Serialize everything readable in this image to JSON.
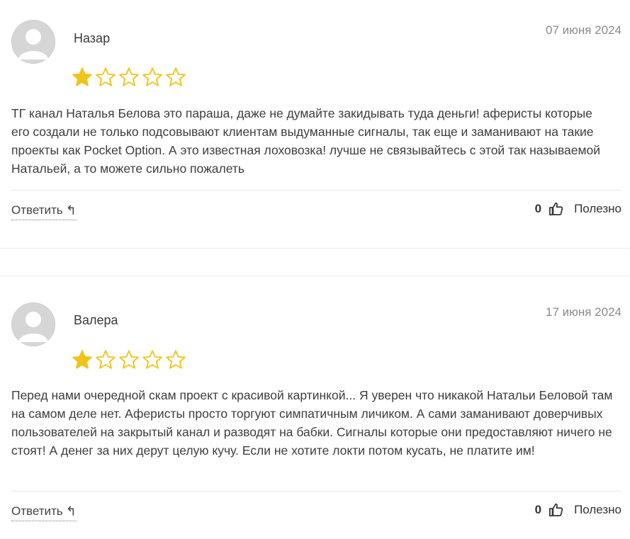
{
  "reviews": [
    {
      "author": "Назар",
      "date": "07 июня 2024",
      "rating": 1,
      "max_rating": 5,
      "text": "ТГ канал Наталья Белова это параша, даже не думайте закидывать туда деньги! аферисты которые его создали не только подсовывают клиентам выдуманные сигналы, так еще и заманивают на такие проекты как Pocket Option. А это известная лоховозка! лучше не связывайтесь с этой так называемой Натальей, а то можете сильно пожалеть",
      "reply_label": "Ответить",
      "helpful_count": "0",
      "helpful_label": "Полезно"
    },
    {
      "author": "Валера",
      "date": "17 июня 2024",
      "rating": 1,
      "max_rating": 5,
      "text": "Перед нами очередной скам проект с красивой картинкой... Я уверен что никакой Натальи Беловой там на самом деле нет. Аферисты просто торгуют симпатичным личиком. А сами заманивают доверчивых пользователей на закрытый канал и разводят на бабки. Сигналы которые они предоставляют ничего не стоят! А денег за них дерут целую кучу. Если не хотите локти потом кусать, не платите им!",
      "reply_label": "Ответить",
      "helpful_count": "0",
      "helpful_label": "Полезно"
    }
  ],
  "icons": {
    "avatar": "user-avatar-placeholder-icon",
    "star_filled": "star-filled-icon",
    "star_empty": "star-outline-icon",
    "reply": "reply-arrow-icon",
    "thumb": "thumbs-up-icon"
  },
  "colors": {
    "star": "#f0c419",
    "text": "#3d3d3d",
    "muted": "#8a8a8a"
  }
}
